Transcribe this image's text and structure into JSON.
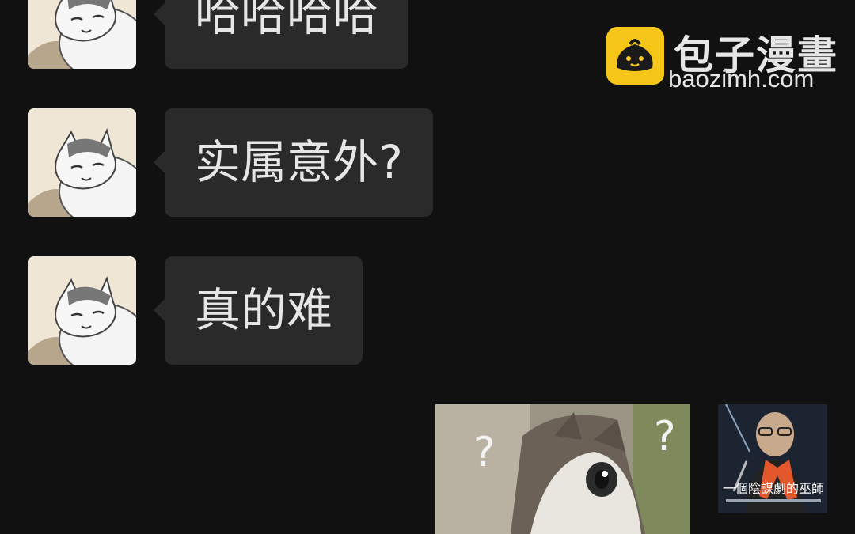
{
  "watermark": {
    "title": "包子漫畫",
    "domain": "baozimh.com",
    "badge_color": "#f5c518"
  },
  "messages": [
    {
      "sender": "other",
      "avatar_icon": "cat-avatar-icon",
      "text": "哈哈哈哈"
    },
    {
      "sender": "other",
      "avatar_icon": "cat-avatar-icon",
      "text": "实属意外?"
    },
    {
      "sender": "other",
      "avatar_icon": "cat-avatar-icon",
      "text": "真的难"
    },
    {
      "sender": "self",
      "type": "sticker",
      "sticker_icon": "confused-cat-sticker-icon"
    }
  ],
  "self_avatar": {
    "icon": "self-avatar-icon",
    "caption": "一個陰謀劇的巫師"
  },
  "colors": {
    "background": "#111111",
    "bubble": "#2a2a2a",
    "text": "#e6e6e6"
  }
}
